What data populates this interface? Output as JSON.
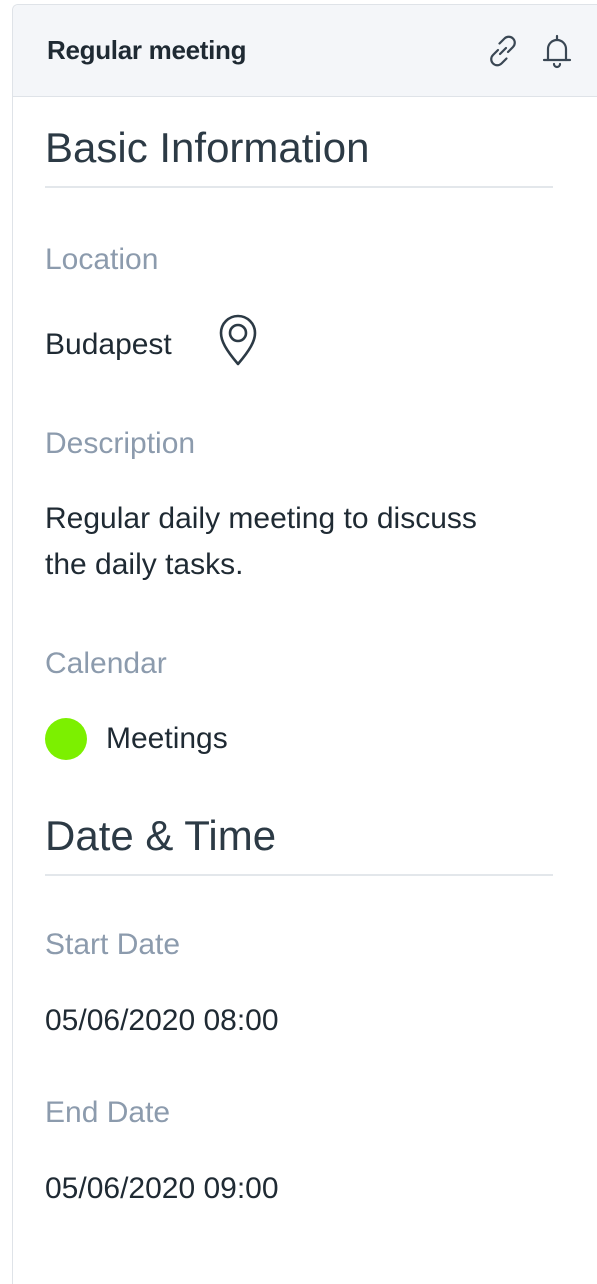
{
  "header": {
    "title": "Regular meeting",
    "icons": [
      "link-icon",
      "bell-icon"
    ]
  },
  "basic": {
    "title": "Basic Information",
    "location_label": "Location",
    "location_value": "Budapest",
    "location_icon": "map-pin-icon",
    "description_label": "Description",
    "description_line1": "Regular daily meeting to discuss",
    "description_line2": "the daily tasks.",
    "calendar_label": "Calendar",
    "calendar_value": "Meetings",
    "calendar_color": "#7cf000"
  },
  "datetime": {
    "title": "Date & Time",
    "start_label": "Start Date",
    "start_value": "05/06/2020 08:00",
    "end_label": "End Date",
    "end_value": "05/06/2020 09:00"
  }
}
